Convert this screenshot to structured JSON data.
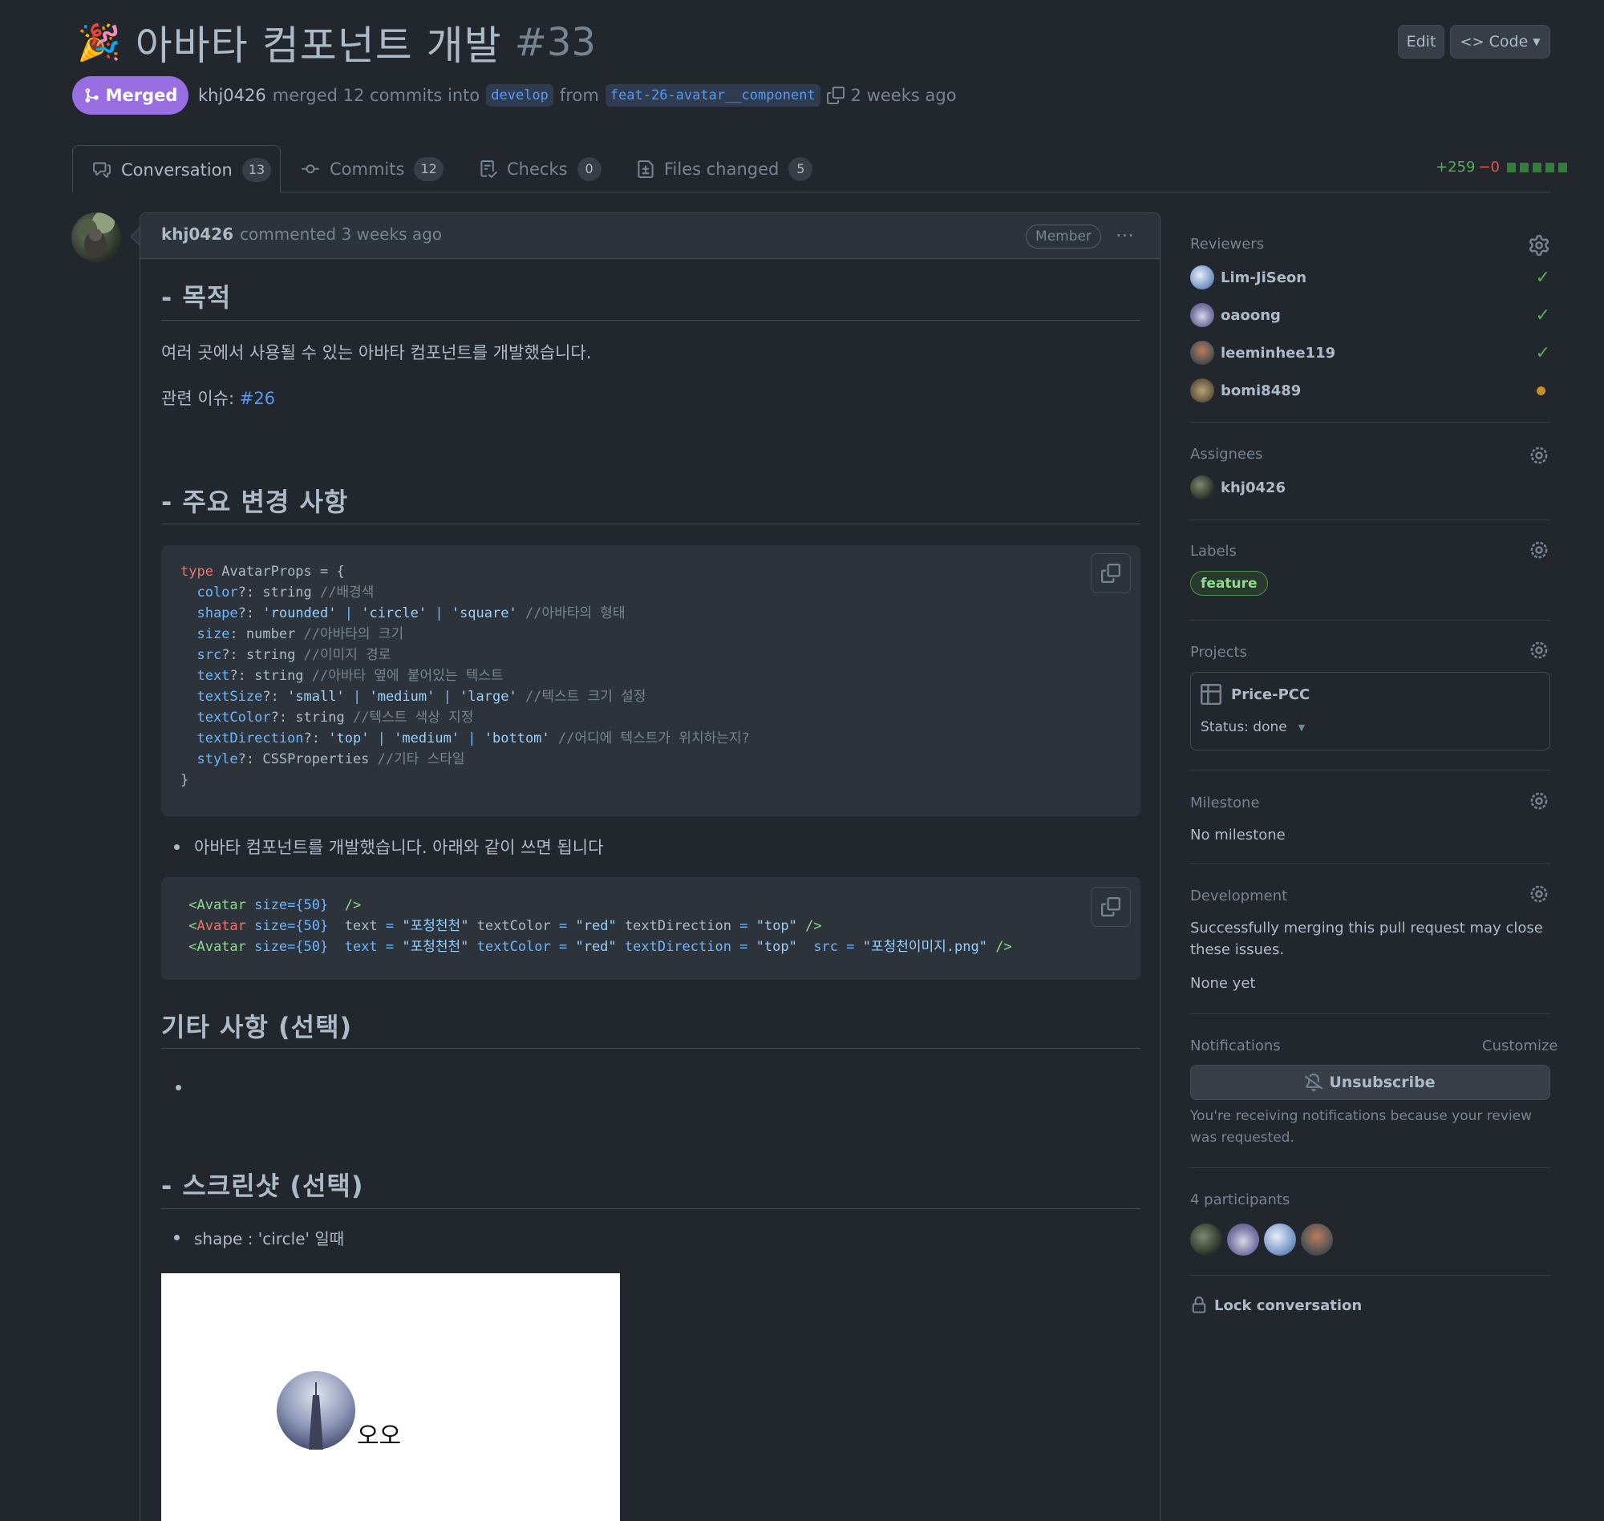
{
  "pr": {
    "emoji": "🎉",
    "title": "아바타 컴포넌트 개발",
    "number": "#33",
    "edit_label": "Edit",
    "code_label": "Code",
    "status": "Merged",
    "author": "khj0426",
    "merge_text": "merged 12 commits into",
    "base_branch": "develop",
    "from_text": "from",
    "head_branch": "feat-26-avatar__component",
    "time_ago": "2 weeks ago"
  },
  "tabs": [
    {
      "label": "Conversation",
      "count": "13"
    },
    {
      "label": "Commits",
      "count": "12"
    },
    {
      "label": "Checks",
      "count": "0"
    },
    {
      "label": "Files changed",
      "count": "5"
    }
  ],
  "diffstat": {
    "additions": "+259",
    "deletions": "−0"
  },
  "comment": {
    "author": "khj0426",
    "action": "commented 3 weeks ago",
    "role": "Member",
    "menu": "···",
    "h_purpose": "- 목적",
    "purpose_text": "여러 곳에서 사용될 수 있는 아바타 컴포넌트를 개발했습니다.",
    "issue_prefix": "관련 이슈: ",
    "issue_link": "#26",
    "h_changes": "- 주요 변경 사항",
    "bullet_usage": "아바타 컴포넌트를 개발했습니다. 아래와 같이 쓰면 됩니다",
    "h_etc": "기타 사항 (선택)",
    "h_screenshot": "- 스크린샷 (선택)",
    "bullet_shape": "shape : 'circle' 일때",
    "screenshot_text": "오오"
  },
  "code1": [
    [
      {
        "c": "kw",
        "t": "type"
      },
      {
        "c": "",
        "t": " AvatarProps = {"
      }
    ],
    [
      {
        "c": "pr",
        "t": "  color"
      },
      {
        "c": "",
        "t": "?: string "
      },
      {
        "c": "cm",
        "t": "//배경색"
      }
    ],
    [
      {
        "c": "pr",
        "t": "  shape"
      },
      {
        "c": "",
        "t": "?: "
      },
      {
        "c": "st",
        "t": "'rounded'"
      },
      {
        "c": "pr",
        "t": " | "
      },
      {
        "c": "st",
        "t": "'circle'"
      },
      {
        "c": "pr",
        "t": " | "
      },
      {
        "c": "st",
        "t": "'square'"
      },
      {
        "c": "cm",
        "t": " //아바타의 형태"
      }
    ],
    [
      {
        "c": "pr",
        "t": "  size"
      },
      {
        "c": "",
        "t": ": number "
      },
      {
        "c": "cm",
        "t": "//아바타의 크기"
      }
    ],
    [
      {
        "c": "pr",
        "t": "  src"
      },
      {
        "c": "",
        "t": "?: string "
      },
      {
        "c": "cm",
        "t": "//이미지 경로"
      }
    ],
    [
      {
        "c": "pr",
        "t": "  text"
      },
      {
        "c": "",
        "t": "?: string "
      },
      {
        "c": "cm",
        "t": "//아바타 옆에 붙어있는 텍스트"
      }
    ],
    [
      {
        "c": "pr",
        "t": "  textSize"
      },
      {
        "c": "",
        "t": "?: "
      },
      {
        "c": "st",
        "t": "'small'"
      },
      {
        "c": "pr",
        "t": " | "
      },
      {
        "c": "st",
        "t": "'medium'"
      },
      {
        "c": "pr",
        "t": " | "
      },
      {
        "c": "st",
        "t": "'large'"
      },
      {
        "c": "cm",
        "t": " //텍스트 크기 설정"
      }
    ],
    [
      {
        "c": "pr",
        "t": "  textColor"
      },
      {
        "c": "",
        "t": "?: string "
      },
      {
        "c": "cm",
        "t": "//텍스트 색상 지정"
      }
    ],
    [
      {
        "c": "pr",
        "t": "  textDirection"
      },
      {
        "c": "",
        "t": "?: "
      },
      {
        "c": "st",
        "t": "'top'"
      },
      {
        "c": "pr",
        "t": " | "
      },
      {
        "c": "st",
        "t": "'medium'"
      },
      {
        "c": "pr",
        "t": " | "
      },
      {
        "c": "st",
        "t": "'bottom'"
      },
      {
        "c": "cm",
        "t": " //어디에 텍스트가 위치하는지?"
      }
    ],
    [
      {
        "c": "pr",
        "t": "  style"
      },
      {
        "c": "",
        "t": "?: CSSProperties "
      },
      {
        "c": "cm",
        "t": "//기타 스타일"
      }
    ],
    [
      {
        "c": "",
        "t": "}"
      }
    ]
  ],
  "code2": [
    [
      {
        "c": "tg",
        "t": " <Avatar"
      },
      {
        "c": "pr",
        "t": " size={50}"
      },
      {
        "c": "",
        "t": "  "
      },
      {
        "c": "tg",
        "t": "/>"
      }
    ],
    [
      {
        "c": "tg",
        "t": " <"
      },
      {
        "c": "kw",
        "t": "Avatar"
      },
      {
        "c": "pr",
        "t": " size={50}"
      },
      {
        "c": "",
        "t": "  text "
      },
      {
        "c": "pr",
        "t": "="
      },
      {
        "c": "st",
        "t": " \"포청천천\""
      },
      {
        "c": "",
        "t": " textColor "
      },
      {
        "c": "pr",
        "t": "="
      },
      {
        "c": "st",
        "t": " \"red\""
      },
      {
        "c": "",
        "t": " textDirection "
      },
      {
        "c": "pr",
        "t": "="
      },
      {
        "c": "st",
        "t": " \"top\""
      },
      {
        "c": "tg",
        "t": " />"
      }
    ],
    [
      {
        "c": "tg",
        "t": " <Avatar"
      },
      {
        "c": "pr",
        "t": " size={50}"
      },
      {
        "c": "pr",
        "t": "  text = "
      },
      {
        "c": "st",
        "t": "\"포청천천\""
      },
      {
        "c": "pr",
        "t": " textColor = "
      },
      {
        "c": "st",
        "t": "\"red\""
      },
      {
        "c": "pr",
        "t": " textDirection = "
      },
      {
        "c": "st",
        "t": "\"top\""
      },
      {
        "c": "pr",
        "t": "  src = "
      },
      {
        "c": "st",
        "t": "\"포청천이미지.png\""
      },
      {
        "c": "tg",
        "t": " />"
      }
    ]
  ],
  "sidebar": {
    "reviewers_title": "Reviewers",
    "reviewers": [
      {
        "name": "Lim-JiSeon",
        "status": "approved"
      },
      {
        "name": "oaoong",
        "status": "approved"
      },
      {
        "name": "leeminhee119",
        "status": "approved"
      },
      {
        "name": "bomi8489",
        "status": "pending"
      }
    ],
    "assignees_title": "Assignees",
    "assignee": "khj0426",
    "labels_title": "Labels",
    "label": "feature",
    "projects_title": "Projects",
    "project_name": "Price-PCC",
    "project_status": "Status: done",
    "milestone_title": "Milestone",
    "milestone": "No milestone",
    "development_title": "Development",
    "development_text": "Successfully merging this pull request may close these issues.",
    "development_none": "None yet",
    "notifications_title": "Notifications",
    "customize": "Customize",
    "unsubscribe": "Unsubscribe",
    "notification_reason": "You're receiving notifications because your review was requested.",
    "participants_title": "4 participants",
    "lock": "Lock conversation"
  },
  "colors": {
    "bg": "#22272e",
    "merged": "#986ee2",
    "link": "#539bf5",
    "approved": "#57ab5a",
    "pending": "#c69026"
  }
}
